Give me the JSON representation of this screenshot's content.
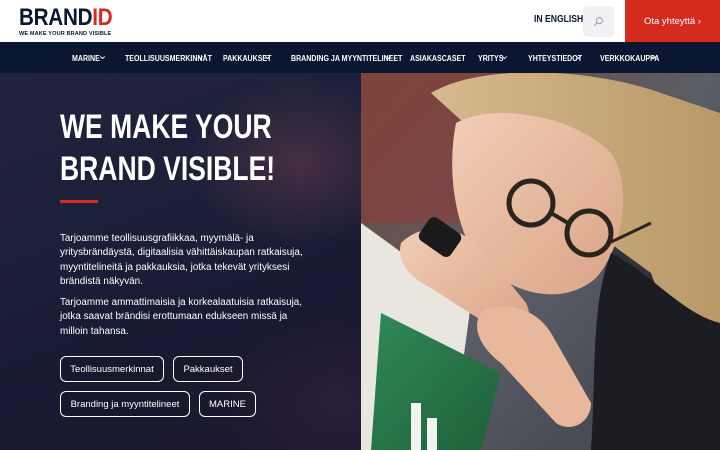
{
  "brand": {
    "logo_main": "BRAND",
    "logo_accent": "ID",
    "tagline": "WE MAKE YOUR BRAND VISIBLE",
    "accent_color": "#d52b1e",
    "navy_color": "#0b1630"
  },
  "header": {
    "language_label": "IN ENGLISH",
    "search_icon": "search-icon",
    "cta_label": "Ota yhteyttä ›"
  },
  "nav": {
    "items": [
      {
        "label": "MARINE",
        "has_dropdown": true
      },
      {
        "label": "TEOLLISUUSMERKINNÄT",
        "has_dropdown": true
      },
      {
        "label": "PAKKAUKSET",
        "has_dropdown": true
      },
      {
        "label": "BRANDING JA MYYNTITELINEET",
        "has_dropdown": true
      },
      {
        "label": "ASIAKASCASET",
        "has_dropdown": false
      },
      {
        "label": "YRITYS",
        "has_dropdown": true
      },
      {
        "label": "YHTEYSTIEDOT",
        "has_dropdown": true
      },
      {
        "label": "VERKKOKAUPPA",
        "has_dropdown": true
      }
    ]
  },
  "hero": {
    "headline_line1": "WE MAKE YOUR",
    "headline_line2": "BRAND VISIBLE!",
    "paragraph1": "Tarjoamme teollisuusgrafiikkaa, myymälä- ja yritysbrändäystä, digitaalisia vähittäiskaupan ratkaisuja, myyntitelineitä ja pakkauksia, jotka tekevät yrityksesi brändistä näkyvän.",
    "paragraph2": "Tarjoamme ammattimaisia ja korkealaatuisia ratkaisuja, jotka saavat brändisi erottumaan edukseen missä ja milloin tahansa.",
    "buttons": [
      {
        "label": "Teollisuusmerkinnat"
      },
      {
        "label": "Pakkaukset"
      },
      {
        "label": "Branding ja myyntitelineet"
      },
      {
        "label": "MARINE"
      }
    ]
  }
}
